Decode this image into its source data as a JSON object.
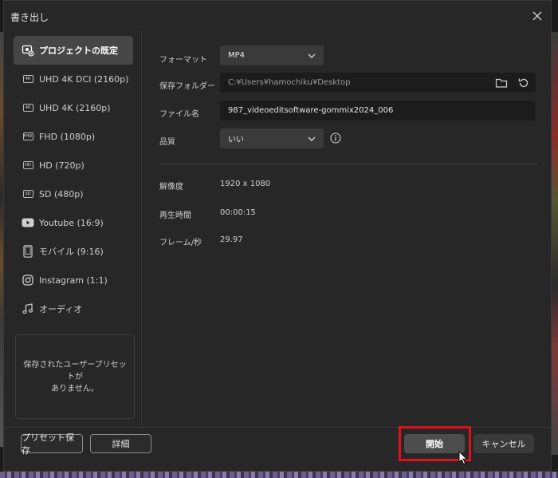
{
  "dialog": {
    "title": "書き出し"
  },
  "sidebar": {
    "items": [
      {
        "label": "プロジェクトの既定",
        "icon": "project-default-icon",
        "active": true
      },
      {
        "label": "UHD 4K DCI (2160p)",
        "icon": "4k-badge-icon",
        "badge": "4K"
      },
      {
        "label": "UHD 4K (2160p)",
        "icon": "4k-badge-icon",
        "badge": "4K"
      },
      {
        "label": "FHD (1080p)",
        "icon": "fhd-badge-icon",
        "badge": "FHD"
      },
      {
        "label": "HD (720p)",
        "icon": "hd-badge-icon",
        "badge": "HD"
      },
      {
        "label": "SD (480p)",
        "icon": "sd-badge-icon",
        "badge": "SD"
      },
      {
        "label": "Youtube (16:9)",
        "icon": "youtube-icon"
      },
      {
        "label": "モバイル (9:16)",
        "icon": "mobile-icon"
      },
      {
        "label": "Instagram (1:1)",
        "icon": "instagram-icon"
      },
      {
        "label": "オーディオ",
        "icon": "music-note-icon"
      }
    ],
    "preset_empty_line1": "保存されたユーザープリセットが",
    "preset_empty_line2": "ありません。"
  },
  "settings": {
    "format_label": "フォーマット",
    "format_value": "MP4",
    "folder_label": "保存フォルダー",
    "folder_value": "C:¥Users¥hamochiku¥Desktop",
    "filename_label": "ファイル名",
    "filename_value": "987_videoeditsoftware-gommix2024_006",
    "quality_label": "品質",
    "quality_value": "いい"
  },
  "info": {
    "resolution_label": "解像度",
    "resolution_value": "1920  x  1080",
    "duration_label": "再生時間",
    "duration_value": "00:00:15",
    "fps_label": "フレーム/秒",
    "fps_value": "29.97"
  },
  "footer": {
    "save_preset_label": "プリセット保存",
    "details_label": "詳細",
    "start_label": "開始",
    "cancel_label": "キャンセル"
  },
  "colors": {
    "highlight": "#e0111b",
    "dialog_bg": "#272727"
  }
}
